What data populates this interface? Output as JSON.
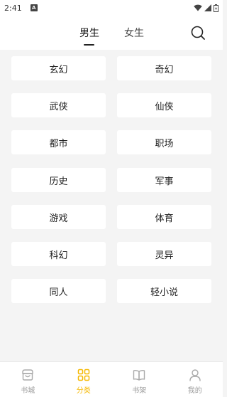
{
  "status_bar": {
    "time": "2:41",
    "notification_badge": "A"
  },
  "header": {
    "tabs": [
      {
        "label": "男生",
        "active": true
      },
      {
        "label": "女生",
        "active": false
      }
    ]
  },
  "categories": [
    "玄幻",
    "奇幻",
    "武侠",
    "仙侠",
    "都市",
    "职场",
    "历史",
    "军事",
    "游戏",
    "体育",
    "科幻",
    "灵异",
    "同人",
    "轻小说"
  ],
  "tabbar": {
    "items": [
      {
        "label": "书城",
        "icon": "bookstore-icon",
        "active": false
      },
      {
        "label": "分类",
        "icon": "category-grid-icon",
        "active": true
      },
      {
        "label": "书架",
        "icon": "bookshelf-icon",
        "active": false
      },
      {
        "label": "我的",
        "icon": "profile-icon",
        "active": false
      }
    ]
  },
  "colors": {
    "accent": "#f5b800",
    "background": "#f4f4f4",
    "inactive": "#9a9a9a"
  }
}
